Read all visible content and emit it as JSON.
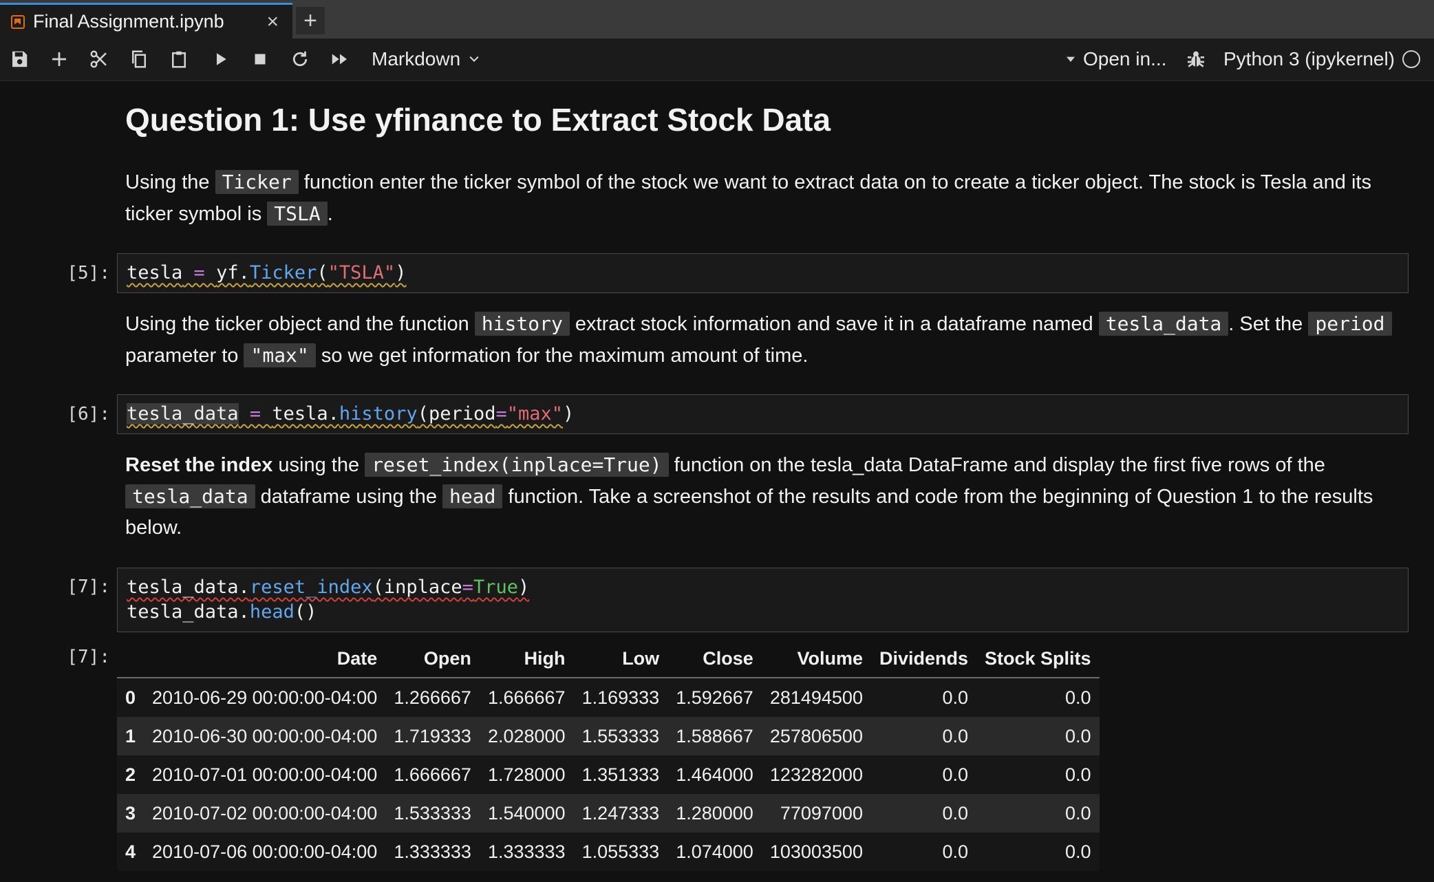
{
  "tab": {
    "title": "Final Assignment.ipynb",
    "close": "×",
    "new": "+"
  },
  "toolbar": {
    "cell_type": "Markdown",
    "open_in": "Open in...",
    "kernel": "Python 3 (ipykernel)",
    "icons": [
      "save-icon",
      "add-cell-icon",
      "cut-icon",
      "copy-icon",
      "paste-icon",
      "run-icon",
      "stop-icon",
      "restart-icon",
      "run-all-icon"
    ]
  },
  "markdown": {
    "heading": "Question 1: Use yfinance to Extract Stock Data",
    "p1": [
      "Using the ",
      "Ticker",
      " function enter the ticker symbol of the stock we want to extract data on to create a ticker object. The stock is Tesla and its ticker symbol is ",
      "TSLA",
      "."
    ],
    "p2": [
      "Using the ticker object and the function ",
      "history",
      " extract stock information and save it in a dataframe named ",
      "tesla_data",
      ". Set the ",
      "period",
      " parameter to ",
      "\"max\"",
      " so we get information for the maximum amount of time."
    ],
    "p3": [
      "Reset the index",
      " using the ",
      "reset_index(inplace=True)",
      " function on the tesla_data DataFrame and display the first five rows of the ",
      "tesla_data",
      " dataframe using the ",
      "head",
      " function. Take a screenshot of the results and code from the beginning of Question 1 to the results below."
    ]
  },
  "cells": [
    {
      "prompt": "[5]:",
      "tokens": [
        "tesla",
        " = ",
        "yf.",
        "Ticker",
        "(",
        "\"TSLA\"",
        ")"
      ]
    },
    {
      "prompt": "[6]:",
      "tokens": [
        "tesla_data",
        " = ",
        "tesla.",
        "history",
        "(period",
        "=",
        "\"max\"",
        ")"
      ]
    },
    {
      "prompt": "[7]:",
      "line1": [
        "tesla_data.",
        "reset_index",
        "(inplace",
        "=",
        "True",
        ")"
      ],
      "line2": [
        "tesla_data.",
        "head",
        "()"
      ]
    }
  ],
  "output": {
    "prompt": "[7]:",
    "columns": [
      "",
      "Date",
      "Open",
      "High",
      "Low",
      "Close",
      "Volume",
      "Dividends",
      "Stock Splits"
    ],
    "rows": [
      [
        "0",
        "2010-06-29 00:00:00-04:00",
        "1.266667",
        "1.666667",
        "1.169333",
        "1.592667",
        "281494500",
        "0.0",
        "0.0"
      ],
      [
        "1",
        "2010-06-30 00:00:00-04:00",
        "1.719333",
        "2.028000",
        "1.553333",
        "1.588667",
        "257806500",
        "0.0",
        "0.0"
      ],
      [
        "2",
        "2010-07-01 00:00:00-04:00",
        "1.666667",
        "1.728000",
        "1.351333",
        "1.464000",
        "123282000",
        "0.0",
        "0.0"
      ],
      [
        "3",
        "2010-07-02 00:00:00-04:00",
        "1.533333",
        "1.540000",
        "1.247333",
        "1.280000",
        "77097000",
        "0.0",
        "0.0"
      ],
      [
        "4",
        "2010-07-06 00:00:00-04:00",
        "1.333333",
        "1.333333",
        "1.055333",
        "1.074000",
        "103003500",
        "0.0",
        "0.0"
      ]
    ]
  }
}
